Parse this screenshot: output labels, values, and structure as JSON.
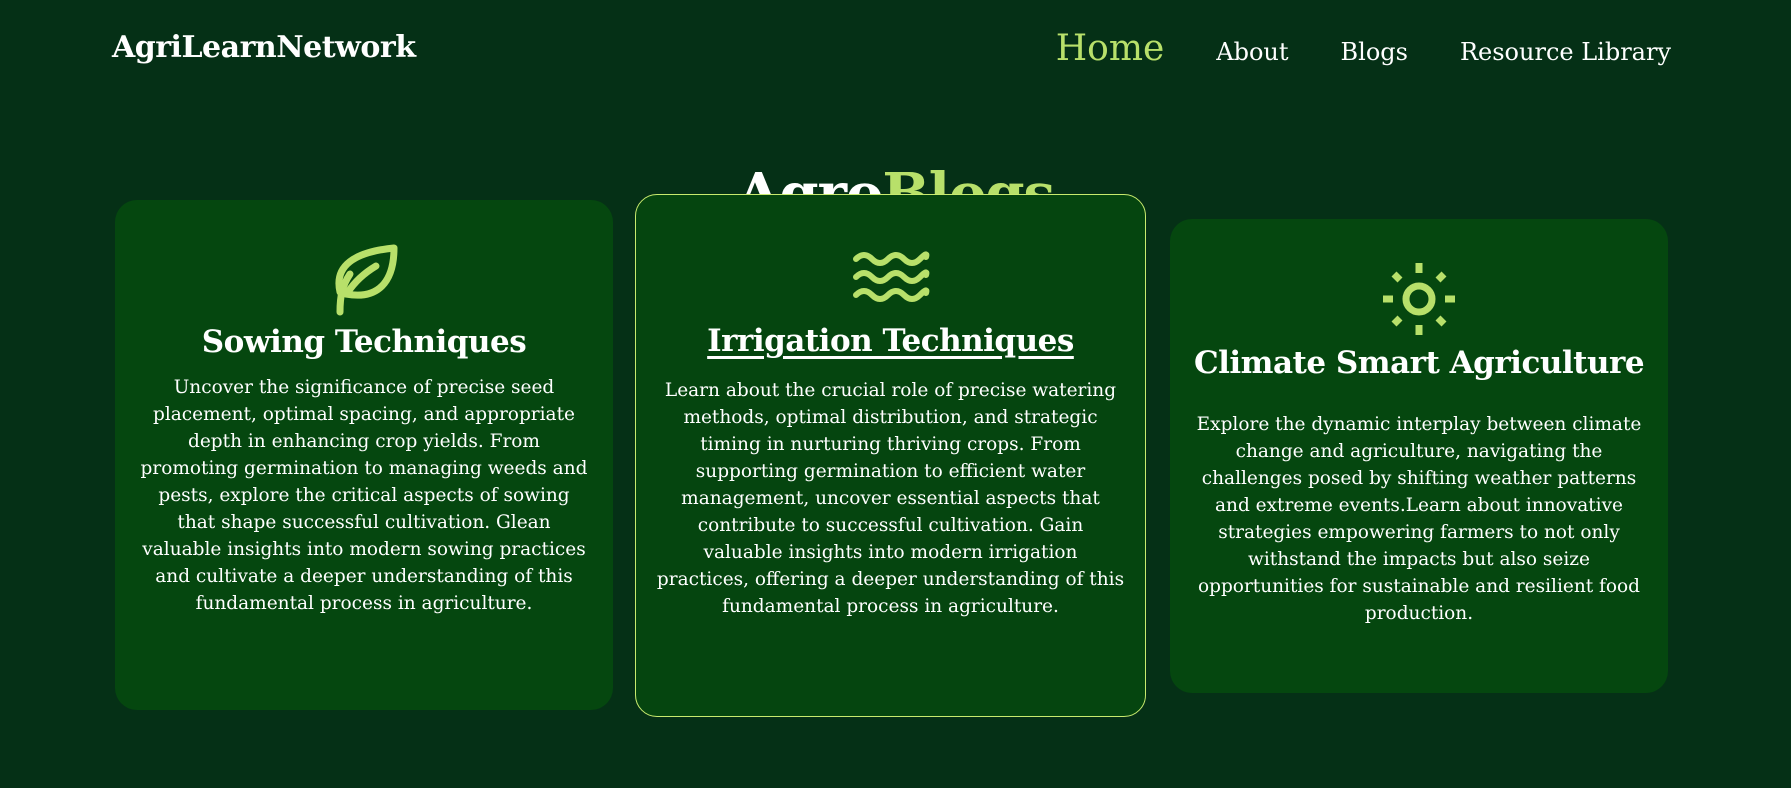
{
  "brand": {
    "name": "AgriLearnNetwork"
  },
  "nav": {
    "items": [
      {
        "label": "Home",
        "active": true
      },
      {
        "label": "About",
        "active": false
      },
      {
        "label": "Blogs",
        "active": false
      },
      {
        "label": "Resource Library",
        "active": false
      }
    ]
  },
  "title": {
    "part1": "Agro",
    "part2": "Blogs"
  },
  "colors": {
    "background": "#053016",
    "card": "#05470f",
    "accent": "#b8e06a"
  },
  "cards": [
    {
      "icon": "leaf-icon",
      "title": "Sowing Techniques",
      "text": "Uncover the significance of precise seed placement, optimal spacing, and appropriate depth in enhancing crop yields. From promoting germination to managing weeds and pests, explore the critical aspects of sowing that shape successful cultivation. Glean valuable insights into modern sowing practices and cultivate a deeper understanding of this fundamental process in agriculture."
    },
    {
      "icon": "water-waves-icon",
      "title": "Irrigation Techniques",
      "text": "Learn about the crucial role of precise watering methods, optimal distribution, and strategic timing in nurturing thriving crops. From supporting germination to efficient water management, uncover essential aspects that contribute to successful cultivation. Gain valuable insights into modern irrigation practices, offering a deeper understanding of this fundamental process in agriculture."
    },
    {
      "icon": "sun-icon",
      "title": "Climate Smart Agriculture",
      "text": "Explore the dynamic interplay between climate change and agriculture, navigating the challenges posed by shifting weather patterns and extreme events.Learn about innovative strategies empowering farmers to not only withstand the impacts but also seize opportunities for sustainable and resilient food production."
    }
  ]
}
